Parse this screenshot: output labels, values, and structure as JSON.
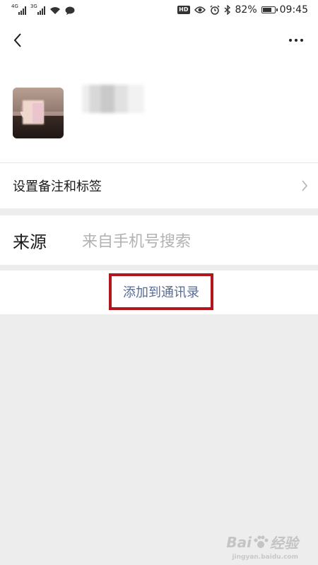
{
  "status_bar": {
    "net1": "4G",
    "net2": "3G",
    "hd": "HD",
    "battery_percent": "82%",
    "battery_level": 0.82,
    "time": "09:45"
  },
  "nav": {
    "back_icon": "chevron-left-icon",
    "more_icon": "more-dots-icon"
  },
  "profile": {
    "avatar": "avatar-image",
    "name_blurred": true
  },
  "remark": {
    "label": "设置备注和标签"
  },
  "source": {
    "label": "来源",
    "value": "来自手机号搜索"
  },
  "action": {
    "add_label": "添加到通讯录",
    "highlight_color": "#b4141c",
    "link_color": "#576b95"
  },
  "watermark": {
    "brand": "Bai",
    "brand_tail": "经验",
    "sub": "jingyan.baidu.com"
  }
}
